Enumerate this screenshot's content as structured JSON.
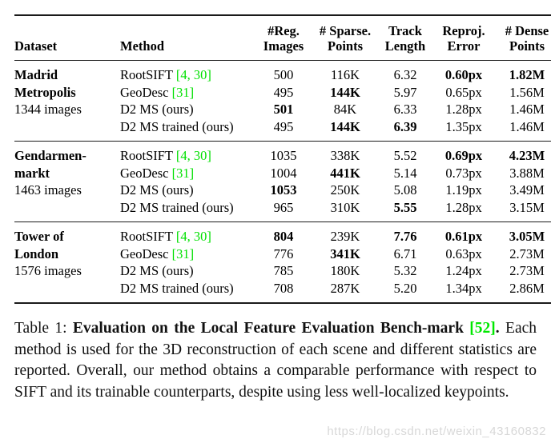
{
  "table": {
    "columns": [
      {
        "id": "dataset",
        "line1": "",
        "line2": "Dataset"
      },
      {
        "id": "method",
        "line1": "",
        "line2": "Method"
      },
      {
        "id": "reg",
        "line1": "#Reg.",
        "line2": "Images"
      },
      {
        "id": "sparse",
        "line1": "# Sparse.",
        "line2": "Points"
      },
      {
        "id": "track",
        "line1": "Track",
        "line2": "Length"
      },
      {
        "id": "reproj",
        "line1": "Reproj.",
        "line2": "Error"
      },
      {
        "id": "dense",
        "line1": "# Dense",
        "line2": "Points"
      }
    ],
    "groups": [
      {
        "name_lines": [
          "Madrid",
          "Metropolis"
        ],
        "images_label": "1344 images",
        "rows": [
          {
            "method": "RootSIFT",
            "cite": "[4, 30]",
            "reg": "500",
            "reg_bold": false,
            "sparse": "116K",
            "sparse_bold": false,
            "track": "6.32",
            "track_bold": false,
            "reproj": "0.60px",
            "reproj_bold": true,
            "dense": "1.82M",
            "dense_bold": true
          },
          {
            "method": "GeoDesc",
            "cite": "[31]",
            "reg": "495",
            "reg_bold": false,
            "sparse": "144K",
            "sparse_bold": true,
            "track": "5.97",
            "track_bold": false,
            "reproj": "0.65px",
            "reproj_bold": false,
            "dense": "1.56M",
            "dense_bold": false
          },
          {
            "method": "D2 MS (ours)",
            "cite": "",
            "reg": "501",
            "reg_bold": true,
            "sparse": "84K",
            "sparse_bold": false,
            "track": "6.33",
            "track_bold": false,
            "reproj": "1.28px",
            "reproj_bold": false,
            "dense": "1.46M",
            "dense_bold": false
          },
          {
            "method": "D2 MS trained (ours)",
            "cite": "",
            "reg": "495",
            "reg_bold": false,
            "sparse": "144K",
            "sparse_bold": true,
            "track": "6.39",
            "track_bold": true,
            "reproj": "1.35px",
            "reproj_bold": false,
            "dense": "1.46M",
            "dense_bold": false
          }
        ]
      },
      {
        "name_lines": [
          "Gendarmen-",
          "markt"
        ],
        "images_label": "1463 images",
        "rows": [
          {
            "method": "RootSIFT",
            "cite": "[4, 30]",
            "reg": "1035",
            "reg_bold": false,
            "sparse": "338K",
            "sparse_bold": false,
            "track": "5.52",
            "track_bold": false,
            "reproj": "0.69px",
            "reproj_bold": true,
            "dense": "4.23M",
            "dense_bold": true
          },
          {
            "method": "GeoDesc",
            "cite": "[31]",
            "reg": "1004",
            "reg_bold": false,
            "sparse": "441K",
            "sparse_bold": true,
            "track": "5.14",
            "track_bold": false,
            "reproj": "0.73px",
            "reproj_bold": false,
            "dense": "3.88M",
            "dense_bold": false
          },
          {
            "method": "D2 MS (ours)",
            "cite": "",
            "reg": "1053",
            "reg_bold": true,
            "sparse": "250K",
            "sparse_bold": false,
            "track": "5.08",
            "track_bold": false,
            "reproj": "1.19px",
            "reproj_bold": false,
            "dense": "3.49M",
            "dense_bold": false
          },
          {
            "method": "D2 MS trained (ours)",
            "cite": "",
            "reg": "965",
            "reg_bold": false,
            "sparse": "310K",
            "sparse_bold": false,
            "track": "5.55",
            "track_bold": true,
            "reproj": "1.28px",
            "reproj_bold": false,
            "dense": "3.15M",
            "dense_bold": false
          }
        ]
      },
      {
        "name_lines": [
          "Tower of",
          "London"
        ],
        "images_label": "1576 images",
        "rows": [
          {
            "method": "RootSIFT",
            "cite": "[4, 30]",
            "reg": "804",
            "reg_bold": true,
            "sparse": "239K",
            "sparse_bold": false,
            "track": "7.76",
            "track_bold": true,
            "reproj": "0.61px",
            "reproj_bold": true,
            "dense": "3.05M",
            "dense_bold": true
          },
          {
            "method": "GeoDesc",
            "cite": "[31]",
            "reg": "776",
            "reg_bold": false,
            "sparse": "341K",
            "sparse_bold": true,
            "track": "6.71",
            "track_bold": false,
            "reproj": "0.63px",
            "reproj_bold": false,
            "dense": "2.73M",
            "dense_bold": false
          },
          {
            "method": "D2 MS (ours)",
            "cite": "",
            "reg": "785",
            "reg_bold": false,
            "sparse": "180K",
            "sparse_bold": false,
            "track": "5.32",
            "track_bold": false,
            "reproj": "1.24px",
            "reproj_bold": false,
            "dense": "2.73M",
            "dense_bold": false
          },
          {
            "method": "D2 MS trained (ours)",
            "cite": "",
            "reg": "708",
            "reg_bold": false,
            "sparse": "287K",
            "sparse_bold": false,
            "track": "5.20",
            "track_bold": false,
            "reproj": "1.34px",
            "reproj_bold": false,
            "dense": "2.86M",
            "dense_bold": false
          }
        ]
      }
    ]
  },
  "caption": {
    "label": "Table 1: ",
    "title_part1": "Evaluation on the Local Feature Evaluation Bench-mark ",
    "title_cite": "[52]",
    "title_end": ". ",
    "body": "Each method is used for the 3D reconstruction of each scene and different statistics are reported. Overall, our method obtains a comparable performance with respect to SIFT and its trainable counterparts, despite using less well-localized keypoints."
  },
  "watermark": {
    "text": "https://blog.csdn.net/weixin_43160832"
  },
  "colors": {
    "citation_green": "#00e000",
    "rule": "#1a1a1a",
    "text": "#000000",
    "watermark": "#d8d8d8"
  }
}
